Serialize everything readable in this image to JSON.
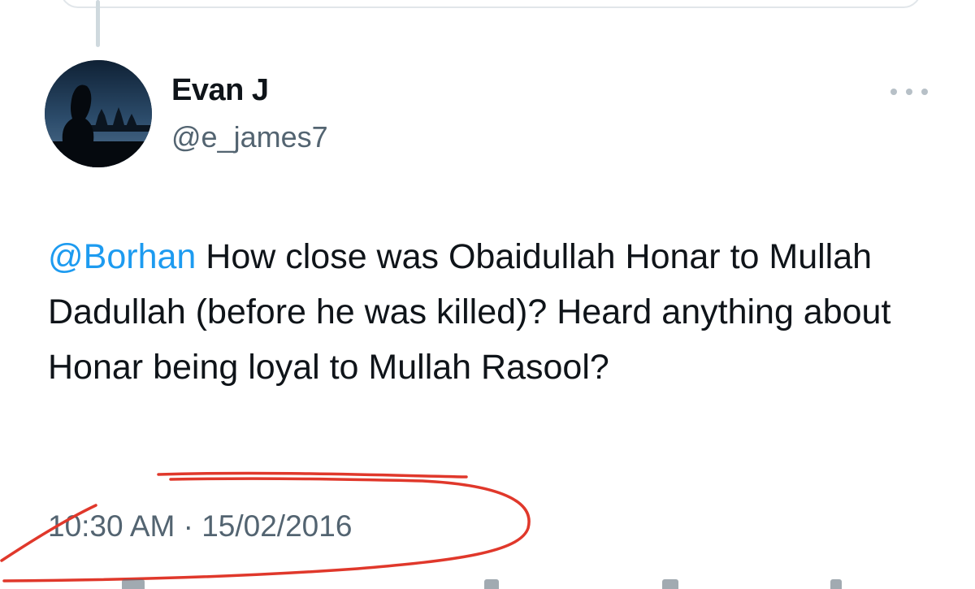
{
  "tweet": {
    "author": {
      "display_name": "Evan J",
      "handle": "@e_james7",
      "avatar": "profile-photo-silhouette-temple"
    },
    "mention": "@Borhan",
    "body": " How close was Obaidullah Honar to Mullah Dadullah (before he was killed)? Heard anything about Honar being loyal to Mullah Rasool?",
    "timestamp": "10:30 AM · 15/02/2016"
  },
  "icons": {
    "more": "more-horizontal-icon"
  },
  "colors": {
    "text": "#0f1419",
    "secondary_text": "#536471",
    "link": "#1d9bf0",
    "annotation": "#e0382b",
    "thread_line": "#cfd9de"
  }
}
